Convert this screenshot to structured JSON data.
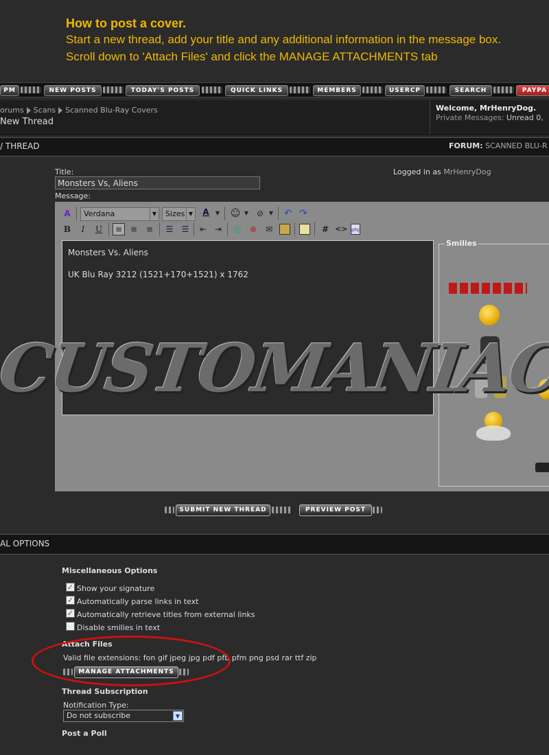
{
  "instructions": {
    "heading": "How to post a cover.",
    "line1": "Start a new thread, add your title and any additional information in the message box.",
    "line2": "Scroll down to 'Attach Files' and click the MANAGE ATTACHMENTS tab"
  },
  "navbar": {
    "items": [
      "PM",
      "NEW POSTS",
      "TODAY'S POSTS",
      "QUICK LINKS",
      "MEMBERS",
      "USERCP",
      "SEARCH",
      "PAYPA"
    ]
  },
  "breadcrumb": {
    "items": [
      "orums",
      "Scans",
      "Scanned Blu-Ray Covers"
    ],
    "page_title": "New Thread"
  },
  "welcome": {
    "greeting": "Welcome, MrHenryDog.",
    "pm_label": "Private Messages:",
    "pm_value": "Unread 0,"
  },
  "thread_bar": {
    "left": "/ THREAD",
    "forum_label": "FORUM:",
    "forum_name": "SCANNED BLU-R"
  },
  "form": {
    "title_label": "Title:",
    "title_value": "Monsters Vs, Aliens",
    "logged_in_label": "Logged in as",
    "logged_in_user": "MrHenryDog",
    "message_label": "Message:"
  },
  "editor": {
    "font": "Verdana",
    "size": "Sizes",
    "text_line1": "Monsters Vs. Aliens",
    "text_line2": "UK Blu Ray  3212 (1521+170+1521) x 1762",
    "smilies_label": "Smilies"
  },
  "watermark": "CUSTOMANIACS.ORG",
  "buttons": {
    "submit": "SUBMIT NEW THREAD",
    "preview": "PREVIEW POST"
  },
  "additional": {
    "header": "AL OPTIONS",
    "misc_title": "Miscellaneous Options",
    "options": [
      {
        "label": "Show your signature",
        "checked": true
      },
      {
        "label": "Automatically parse links in text",
        "checked": true
      },
      {
        "label": "Automatically retrieve titles from external links",
        "checked": true
      },
      {
        "label": "Disable smilies in text",
        "checked": false
      }
    ],
    "attach_title": "Attach Files",
    "extensions": "Valid file extensions: fon gif jpeg jpg pdf pfb pfm png psd rar ttf zip",
    "manage_button": "MANAGE ATTACHMENTS",
    "subscription_title": "Thread Subscription",
    "notification_label": "Notification Type:",
    "notification_value": "Do not subscribe",
    "poll_title": "Post a Poll"
  },
  "colors": {
    "accent_orange": "#f0b800",
    "annotation_red": "#d01010",
    "checkbox_green": "#0a8a0a"
  }
}
